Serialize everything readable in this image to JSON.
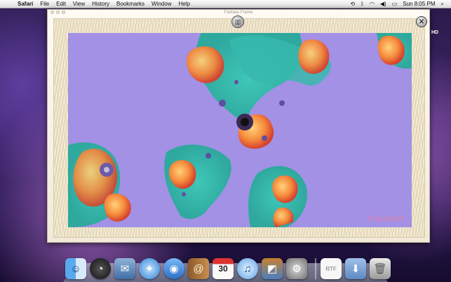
{
  "menubar": {
    "app_name": "Safari",
    "items": [
      "File",
      "Edit",
      "View",
      "History",
      "Bookmarks",
      "Window",
      "Help"
    ],
    "clock": "Sun 8:05 PM"
  },
  "window": {
    "title": "Fantasy Frame"
  },
  "watermark": "FractalArt",
  "hd_label": "HD",
  "calendar_day": "30",
  "dock_icons": [
    "finder-icon",
    "dashboard-icon",
    "mail-icon",
    "safari-icon",
    "ichat-icon",
    "address-book-icon",
    "ical-icon",
    "itunes-icon",
    "iphoto-icon",
    "system-preferences-icon",
    "document-icon",
    "folder-icon",
    "trash-icon"
  ]
}
